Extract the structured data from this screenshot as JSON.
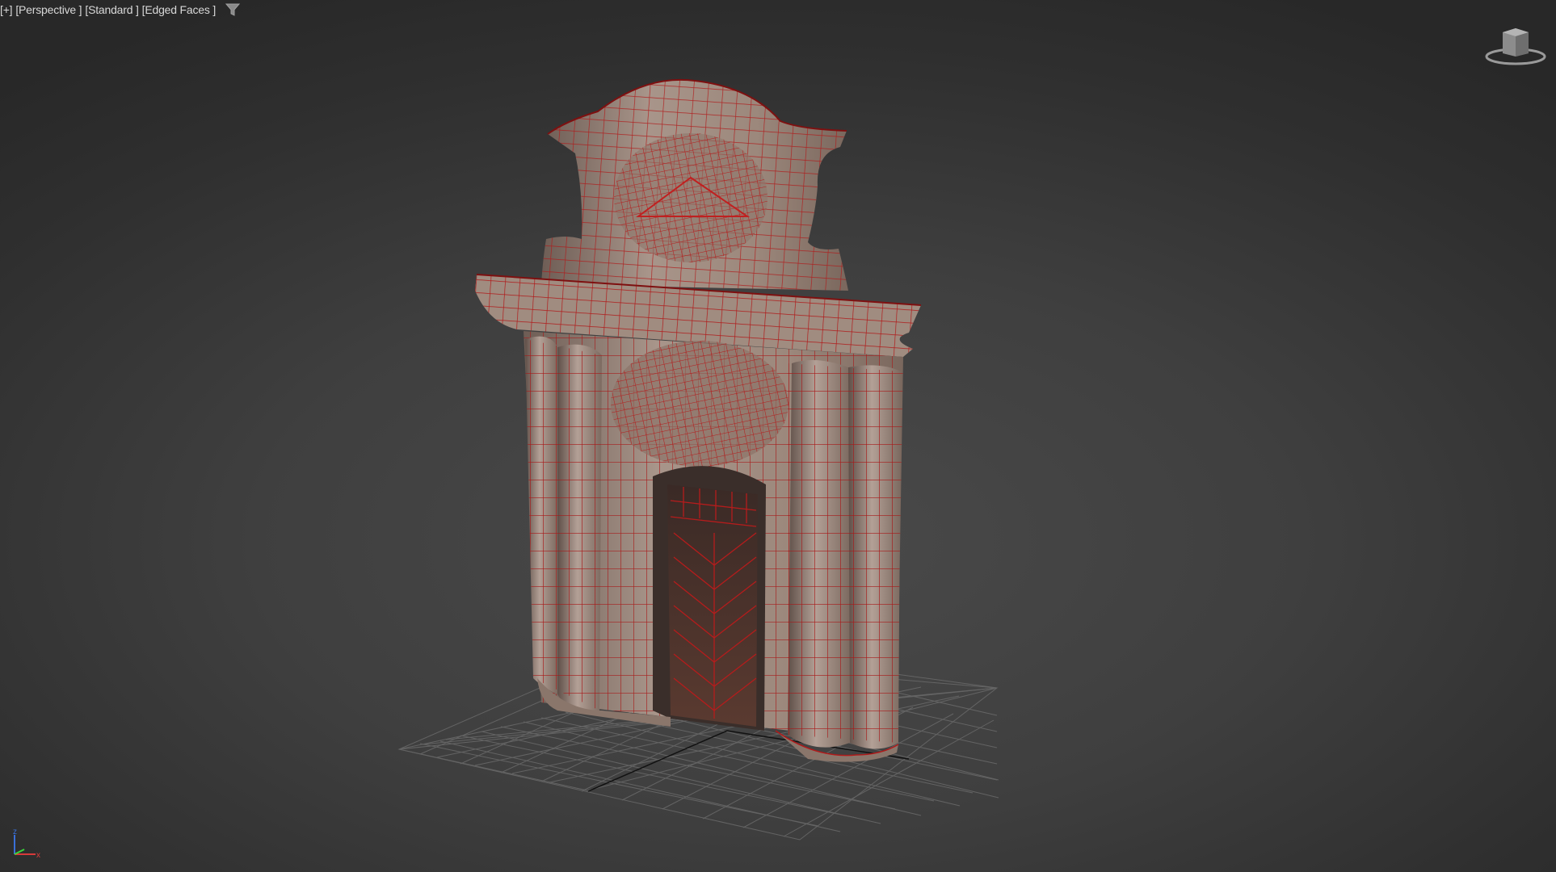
{
  "viewport": {
    "labels": {
      "menu": "[+]",
      "view": "[Perspective ]",
      "shading": "[Standard ]",
      "display": "[Edged Faces ]"
    },
    "filter_icon": "funnel-icon",
    "viewcube_icon": "viewcube-icon",
    "axis": {
      "z": "z",
      "x": "x"
    }
  },
  "colors": {
    "wire": "#b01a1a",
    "stone": "#9a8478",
    "grid": "#6a6a6a",
    "background": "#3c3c3c"
  }
}
